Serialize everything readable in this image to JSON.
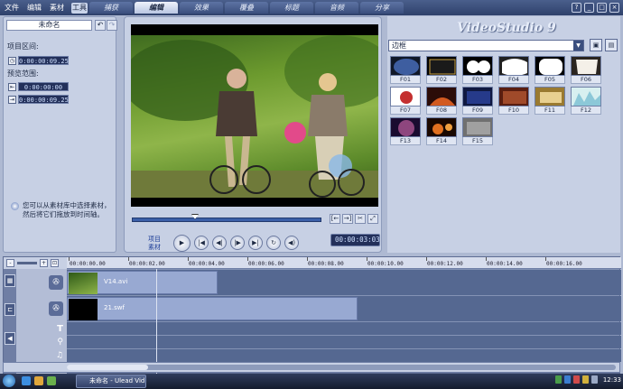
{
  "menu": [
    "文件",
    "编辑",
    "素材",
    "工具"
  ],
  "steps": [
    "捕获",
    "编辑",
    "效果",
    "覆叠",
    "标题",
    "音频",
    "分享"
  ],
  "selected_step": "编辑",
  "window_buttons": [
    "?",
    "_",
    "□",
    "×"
  ],
  "project": {
    "name": "未命名",
    "duration_label": "项目区间:",
    "duration": "0:00:00:09.25",
    "range_label": "预览范围:",
    "range_start": "0:00:00:00",
    "range_end": "0:00:00:09.25"
  },
  "hint": "您可以从素材库中选择素材，然后将它们拖放到时间轴。",
  "preview": {
    "mode_project": "项目",
    "mode_clip": "素材",
    "timecode": "00:00:03:03"
  },
  "library": {
    "brand": "VideoStudio 9",
    "category": "边框",
    "items": [
      {
        "label": "F01",
        "bg": "#101828",
        "shape": "oval"
      },
      {
        "label": "F02",
        "bg": "#000000",
        "shape": "edge"
      },
      {
        "label": "F03",
        "bg": "#000000",
        "shape": "circles"
      },
      {
        "label": "F04",
        "bg": "#202020",
        "shape": "blob"
      },
      {
        "label": "F05",
        "bg": "#000000",
        "shape": "white"
      },
      {
        "label": "F06",
        "bg": "#2a2520",
        "shape": "torn"
      },
      {
        "label": "F07",
        "bg": "#ffffff",
        "shape": "inkred"
      },
      {
        "label": "F08",
        "bg": "#2b0c08",
        "shape": "fire"
      },
      {
        "label": "F09",
        "bg": "#0f1840",
        "shape": "blue"
      },
      {
        "label": "F10",
        "bg": "#5a1e10",
        "shape": "brown"
      },
      {
        "label": "F11",
        "bg": "#9a7a30",
        "shape": "gold"
      },
      {
        "label": "F12",
        "bg": "#d8f0f0",
        "shape": "ice"
      },
      {
        "label": "F13",
        "bg": "#1a0c30",
        "shape": "purple"
      },
      {
        "label": "F14",
        "bg": "#1a0800",
        "shape": "ember"
      },
      {
        "label": "F15",
        "bg": "#707070",
        "shape": "gray"
      }
    ]
  },
  "timeline": {
    "ticks": [
      "00:00:00.00",
      "00:00:02.00",
      "00:00:04.00",
      "00:00:06.00",
      "00:00:08.00",
      "00:00:10.00",
      "00:00:12.00",
      "00:00:14.00",
      "00:00:16.00"
    ],
    "video_clip": "V14.avi",
    "overlay_clip": "21.swf"
  },
  "taskbar": {
    "task": "未命名 - Ulead Vid...",
    "clock": "12:33"
  }
}
